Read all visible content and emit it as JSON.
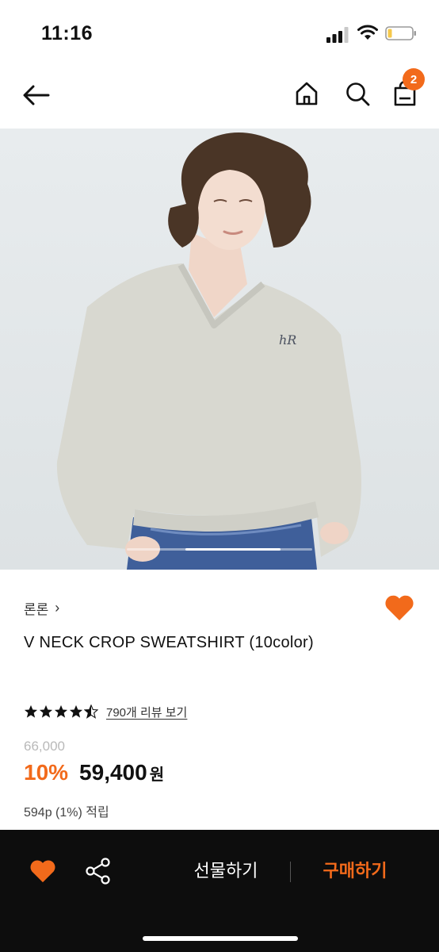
{
  "status": {
    "time": "11:16",
    "signal_icon": "cellular-signal-icon",
    "wifi_icon": "wifi-icon",
    "battery_icon": "battery-low-icon",
    "battery_color": "#f5c84b"
  },
  "header": {
    "back_icon": "arrow-left-icon",
    "home_icon": "home-icon",
    "search_icon": "search-icon",
    "bag_icon": "shopping-bag-icon",
    "cart_count": "2"
  },
  "gallery": {
    "image_alt": "product-photo",
    "current_index": 2,
    "total": 3
  },
  "product": {
    "brand": "론론",
    "brand_chevron": "›",
    "title": "V NECK CROP SWEATSHIRT (10color)",
    "rating": 4.5,
    "review_text": "790개 리뷰 보기",
    "original_price": "66,000",
    "discount": "10%",
    "price": "59,400",
    "currency": "원",
    "points": "594p (1%) 적립"
  },
  "bottom_bar": {
    "like_icon": "heart-icon",
    "share_icon": "share-icon",
    "gift_label": "선물하기",
    "buy_label": "구매하기"
  },
  "colors": {
    "accent": "#f26a1b",
    "bottom_bar_bg": "#0d0d0d",
    "image_bg": "#e4e8ea"
  }
}
